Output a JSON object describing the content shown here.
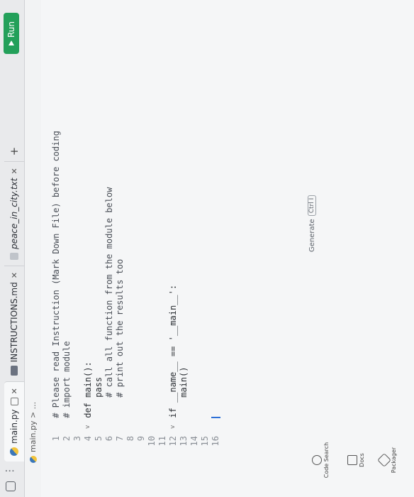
{
  "tabs": [
    {
      "label": "main.py",
      "active": true
    },
    {
      "label": "INSTRUCTIONS.md",
      "active": false
    },
    {
      "label": "peace_in_city.txt",
      "active": false
    }
  ],
  "run_label": "Run",
  "breadcrumb": "main.py > ...",
  "code_lines": [
    {
      "n": "1",
      "fold": "",
      "text": "# Please read Instruction (Mark Down File) before coding"
    },
    {
      "n": "2",
      "fold": "",
      "text": "# import module"
    },
    {
      "n": "3",
      "fold": "",
      "text": ""
    },
    {
      "n": "4",
      "fold": "v",
      "text": "def main():"
    },
    {
      "n": "5",
      "fold": "",
      "text": "    pass"
    },
    {
      "n": "6",
      "fold": "",
      "text": "    # call all function from the module below"
    },
    {
      "n": "7",
      "fold": "",
      "text": "    # print out the results too"
    },
    {
      "n": "8",
      "fold": "",
      "text": ""
    },
    {
      "n": "9",
      "fold": "",
      "text": ""
    },
    {
      "n": "10",
      "fold": "",
      "text": ""
    },
    {
      "n": "11",
      "fold": "",
      "text": ""
    },
    {
      "n": "12",
      "fold": "v",
      "text": "if __name__ == '__main__':"
    },
    {
      "n": "13",
      "fold": "",
      "text": "    main()"
    },
    {
      "n": "14",
      "fold": "",
      "text": ""
    },
    {
      "n": "15",
      "fold": "",
      "text": ""
    },
    {
      "n": "16",
      "fold": "",
      "text": ""
    }
  ],
  "generate_label": "Generate",
  "generate_shortcut": "Ctrl I",
  "tools": {
    "code_search": "Code Search",
    "docs": "Docs",
    "packager": "Packager"
  },
  "colors": {
    "run": "#23a05a",
    "cursor": "#2c6fd6"
  }
}
